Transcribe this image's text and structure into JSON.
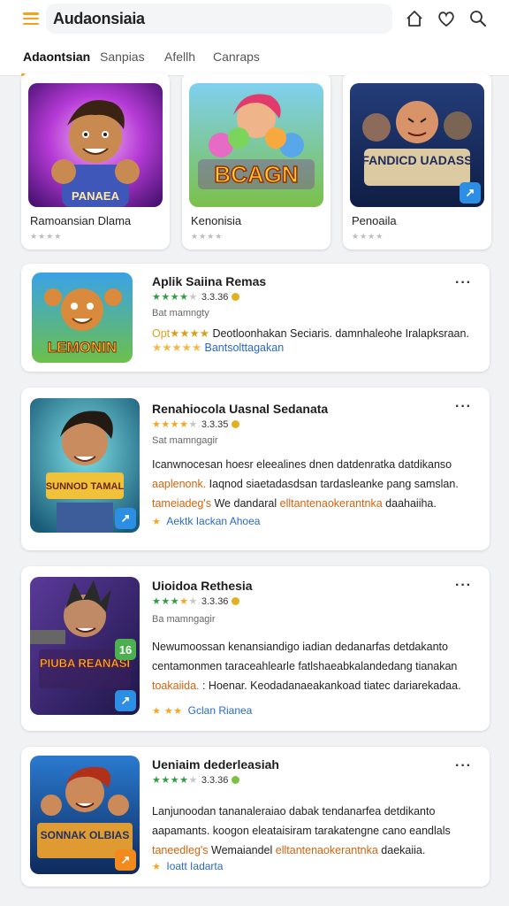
{
  "header": {
    "app_title": "Audaonsiaia",
    "icons": [
      "menu-icon",
      "home-icon",
      "heart-icon",
      "search-icon"
    ]
  },
  "tabs": [
    {
      "label": "Adaontsian",
      "active": true
    },
    {
      "label": "Sanpias",
      "active": false
    },
    {
      "label": "Afellh",
      "active": false
    },
    {
      "label": "Canraps",
      "active": false
    }
  ],
  "featured": [
    {
      "title": "Ramoansian Dlama",
      "stars": "★★★★",
      "thumb_text": "PANAEA"
    },
    {
      "title": "Kenonisia",
      "stars": "★★★★",
      "thumb_text": "BCAGN"
    },
    {
      "title": "Penoaila",
      "stars": "★★★★",
      "thumb_text": "FANDICD UADASS"
    }
  ],
  "apps": [
    {
      "title": "Aplik Saiina Remas",
      "rating_text": "3.3.36",
      "rating_stars": 4,
      "meta": "Bat mamngty",
      "thumb_text": "LEMONIN",
      "desc_lines": [
        {
          "pre": "Opt★★★★ ",
          "text": "Deotloonhakan Seciaris. damnhaleohe Iralapksraan."
        },
        {
          "pre": "★★★★★ ",
          "text": "Bantsolttagakan"
        }
      ],
      "footer_link": ""
    },
    {
      "title": "Renahiocola Uasnal Sedanata",
      "rating_text": "3.3.35",
      "rating_stars": 4,
      "meta": "Sat mamngagir",
      "thumb_text": "SUNNOD TAMAL",
      "desc_lines": [
        {
          "pre": "",
          "text": "Icanwnocesan hoesr eleealines dnen datdenratka datdikanso"
        },
        {
          "pre": "aaplenonk.",
          "text": " Iaqnod siaetadasdsan tardasleanke pang samslan."
        },
        {
          "pre": "tameiadeg's",
          "text": " We dandaral ",
          "post": "elltantenaokerantnka",
          "tail": " daahaiiha."
        }
      ],
      "footer_link": "Aektk Iackan Ahoea"
    },
    {
      "title": "Uioidoa Rethesia",
      "rating_text": "3.3.36",
      "rating_stars": 4,
      "meta": "Ba mamngagir",
      "thumb_text": "PIUBA REANASI",
      "desc_lines": [
        {
          "pre": "",
          "text": "Newumoossan kenansiandigo iadian dedanarfas detdakanto"
        },
        {
          "pre": "",
          "text": "centamonmen taraceahlearle fatlshaeabkalandedang tianakan"
        },
        {
          "pre": "toakaiida. ",
          "text": ": Hoenar. Keodadanaeakankoad tiatec dariarekadaa."
        }
      ],
      "footer_link": "Gclan Rianea"
    },
    {
      "title": "Ueniaim dederleasiah",
      "rating_text": "3.3.36",
      "rating_stars": 4,
      "meta": "",
      "thumb_text": "SONNAK OLBIAS",
      "desc_lines": [
        {
          "pre": "",
          "text": "Lanjunoodan tananaleraiao dabak tendanarfea detdikanto"
        },
        {
          "pre": "",
          "text": "aapamants. koogon eleataisiram tarakatengne cano eandlals"
        },
        {
          "pre": "taneedleg's",
          "text": " Wemaiandel ",
          "post": "elltantenaokerantnka",
          "tail": " daekaiia."
        }
      ],
      "footer_link": "Ioatt Iadarta"
    }
  ],
  "colors": {
    "accent": "#f2a31b",
    "star_green": "#2e9d44",
    "star_gold": "#f5a623",
    "link": "#2769c7",
    "highlight": "#d0640e"
  }
}
